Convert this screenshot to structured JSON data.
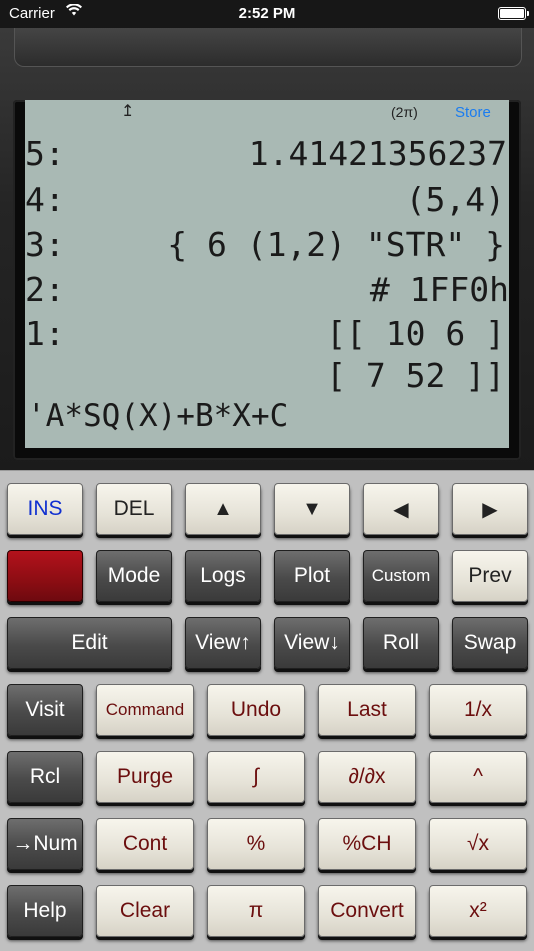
{
  "status_bar": {
    "carrier": "Carrier",
    "time": "2:52 PM"
  },
  "screen": {
    "annunciator_arrow": "↥",
    "angle_mode": "(2π)",
    "store_label": "Store",
    "stack": [
      {
        "level": "5:",
        "value": "1.41421356237"
      },
      {
        "level": "4:",
        "value": "(5,4)"
      },
      {
        "level": "3:",
        "value": "{ 6 (1,2) \"STR\" }"
      },
      {
        "level": "2:",
        "value": "# 1FF0h"
      },
      {
        "level": "1:",
        "value": "[[ 10 6 ]"
      },
      {
        "level": "",
        "value": "[ 7 52 ]]"
      }
    ],
    "command_line": "'A*SQ(X)+B*X+C"
  },
  "keys": {
    "row1": [
      "INS",
      "DEL",
      "▲",
      "▼",
      "◀",
      "▶"
    ],
    "row2": [
      "",
      "Mode",
      "Logs",
      "Plot",
      "Custom",
      "Prev"
    ],
    "row3": [
      "Edit",
      "View↑",
      "View↓",
      "Roll",
      "Swap"
    ],
    "row4": [
      "Visit",
      "Command",
      "Undo",
      "Last",
      "1/x"
    ],
    "row5": [
      "Rcl",
      "Purge",
      "∫",
      "∂/∂x",
      "^"
    ],
    "row6": [
      "→Num",
      "Cont",
      "%",
      "%CH",
      "√x"
    ],
    "row7": [
      "Help",
      "Clear",
      "π",
      "Convert",
      "x²"
    ]
  },
  "colors": {
    "lcd_background": "#a9b9b4",
    "store_link": "#1b7cf0",
    "shift_key": "#a0101a",
    "cream_key_text": "#6b0e0e",
    "ins_text": "#1030d0"
  }
}
